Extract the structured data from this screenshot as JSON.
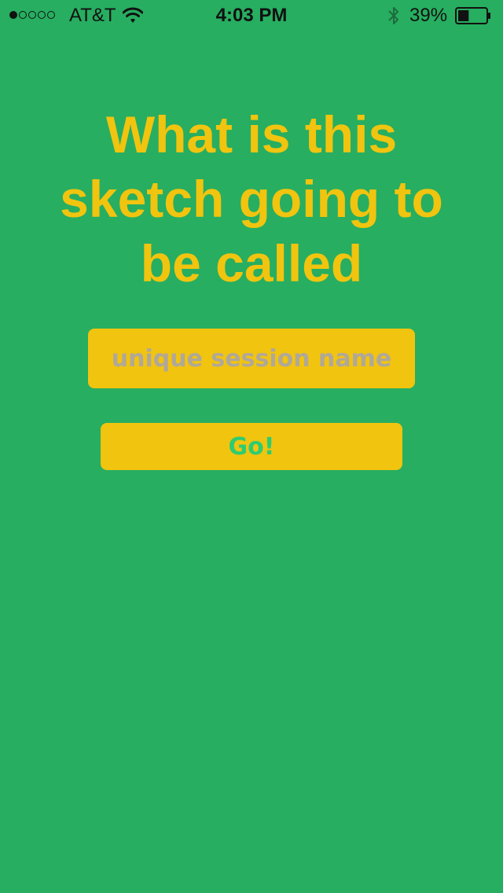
{
  "status_bar": {
    "signal_bars_filled": 1,
    "signal_bars_total": 5,
    "carrier": "AT&T",
    "wifi_icon": "wifi-icon",
    "time": "4:03 PM",
    "bluetooth_icon": "bluetooth-icon",
    "battery_percent": "39%",
    "battery_level": 0.39
  },
  "main": {
    "title": "What is this sketch going to be called",
    "session_input": {
      "value": "",
      "placeholder": "unique session name"
    },
    "go_label": "Go!"
  },
  "colors": {
    "background": "#27ae60",
    "accent": "#f1c40f",
    "button_text": "#2ecc71",
    "placeholder": "#b0a898"
  }
}
